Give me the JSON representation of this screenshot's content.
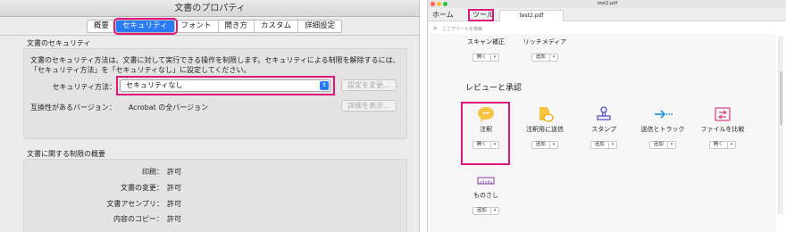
{
  "dialog": {
    "title": "文書のプロパティ",
    "tabs": [
      {
        "label": "概要",
        "selected": false
      },
      {
        "label": "セキュリティ",
        "selected": true
      },
      {
        "label": "フォント",
        "selected": false
      },
      {
        "label": "開き方",
        "selected": false
      },
      {
        "label": "カスタム",
        "selected": false
      },
      {
        "label": "詳細設定",
        "selected": false
      }
    ],
    "security_section_title": "文書のセキュリティ",
    "security_description_line1": "文書のセキュリティ方法は、文書に対して実行できる操作を制限します。セキュリティによる制限を解除するには、",
    "security_description_line2": "「セキュリティ方法」を「セキュリティなし」に設定してください。",
    "security_method_label": "セキュリティ方法：",
    "security_method_value": "セキュリティなし",
    "change_settings_button": "設定を変更...",
    "compat_label": "互換性があるバージョン：",
    "compat_value": "Acrobat の全バージョン",
    "show_details_button": "詳細を表示...",
    "restrictions_title": "文書に関する制限の概要",
    "restrictions": [
      {
        "key": "印刷：",
        "value": "許可"
      },
      {
        "key": "文書の変更：",
        "value": "許可"
      },
      {
        "key": "文書アセンブリ：",
        "value": "許可"
      },
      {
        "key": "内容のコピー：",
        "value": "許可"
      }
    ],
    "colors": {
      "highlight": "#e0177d",
      "selected_tab": "#2a7cf2"
    }
  },
  "acrobat": {
    "window_title": "test2.pdf",
    "tabs": {
      "home": "ホーム",
      "tools": "ツール",
      "file": "test2.pdf"
    },
    "search_placeholder": "ここでツールを検索",
    "top_tools": [
      {
        "label": "スキャン補正",
        "button": "開く"
      },
      {
        "label": "リッチメディア",
        "button": "追加"
      }
    ],
    "review_section_title": "レビューと承認",
    "review_tools": [
      {
        "label": "注釈",
        "button": "開く",
        "icon": "comment-icon"
      },
      {
        "label": "注釈用に送信",
        "button": "追加",
        "icon": "send-for-comments-icon"
      },
      {
        "label": "スタンプ",
        "button": "追加",
        "icon": "stamp-icon"
      },
      {
        "label": "送信とトラック",
        "button": "追加",
        "icon": "send-and-track-icon"
      },
      {
        "label": "ファイルを比較",
        "button": "開く",
        "icon": "compare-files-icon"
      }
    ],
    "ruler_tool": {
      "label": "ものさし",
      "button": "追加",
      "icon": "ruler-icon"
    },
    "dropdown_glyph": "▾",
    "colors": {
      "comment": "#f2b416",
      "send": "#e8a400",
      "stamp": "#5b57c8",
      "track": "#1b8fd6",
      "compare": "#d6458d",
      "ruler": "#9b59b6"
    }
  }
}
